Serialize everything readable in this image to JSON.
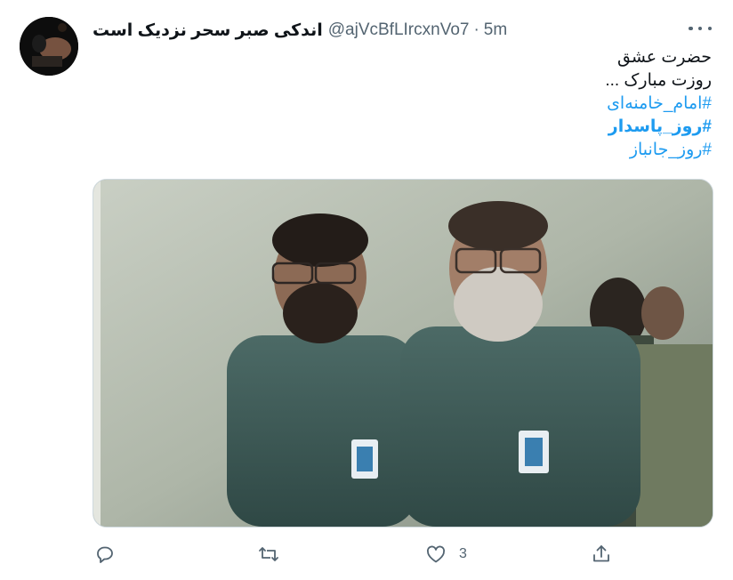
{
  "tweet": {
    "display_name": "اندکی صبر سحر نزدیک است",
    "handle": "@ajVcBfLIrcxnVo7",
    "separator": "·",
    "time": "5m",
    "lines": [
      "حضرت عشق",
      "روزت مبارک ..."
    ],
    "hashtags": [
      "#امام_خامنه‌ای",
      "#روز_پاسدار",
      "#روز_جانباز"
    ]
  },
  "actions": {
    "like_count": "3"
  },
  "icons": {
    "reply": "reply-icon",
    "retweet": "retweet-icon",
    "like": "heart-icon",
    "share": "share-icon",
    "more": "more-icon"
  },
  "colors": {
    "link": "#1d9bf0",
    "muted": "#536471",
    "text": "#0f1419"
  }
}
